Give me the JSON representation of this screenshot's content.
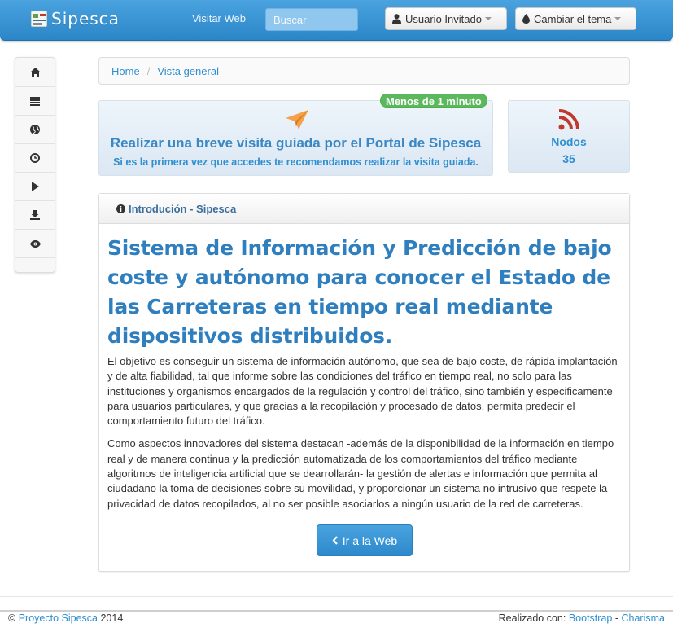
{
  "navbar": {
    "brand": "Sipesca",
    "visit_link": "Visitar Web",
    "search_placeholder": "Buscar",
    "user_button": "Usuario Invitado",
    "theme_button": "Cambiar el tema",
    "colors": {
      "bar": "#2b86c8",
      "accent": "#2f8fd0"
    }
  },
  "sidebar": {
    "items": [
      {
        "icon": "home-icon"
      },
      {
        "icon": "list-icon"
      },
      {
        "icon": "globe-icon"
      },
      {
        "icon": "clock-icon"
      },
      {
        "icon": "play-icon"
      },
      {
        "icon": "download-icon"
      },
      {
        "icon": "eye-icon"
      }
    ]
  },
  "breadcrumb": {
    "home": "Home",
    "separator": "/",
    "current": "Vista general"
  },
  "tour": {
    "badge": "Menos de 1 minuto",
    "title": "Realizar una breve visita guiada por el Portal de Sipesca",
    "subtitle": "Si es la primera vez que accedes te recomendamos realizar la visita guiada.",
    "icon": "paper-plane-icon"
  },
  "nodes": {
    "label": "Nodos",
    "count": "35",
    "icon": "rss-icon"
  },
  "intro": {
    "header": "Introdución - Sipesca",
    "heading": "Sistema de Información y Predicción de bajo coste y autónomo para conocer el Estado de las Carreteras en tiempo real mediante dispositivos distribuidos.",
    "paragraph1": "El objetivo es conseguir un sistema de información autónomo, que sea de bajo coste, de rápida implantación y de alta fiabilidad, tal que informe sobre las condiciones del tráfico en tiempo real, no solo para las instituciones y organismos encargados de la regulación y control del tráfico, sino también y especificamente para usuarios particulares, y que gracias a la recopilación y procesado de datos, permita predecir el comportamiento futuro del tráfico.",
    "paragraph2": "Como aspectos innovadores del sistema destacan -además de la disponibilidad de la información en tiempo real y de manera continua y la predicción automatizada de los comportamientos del tráfico mediante algoritmos de inteligencia artificial que se dearrollarán- la gestión de alertas e información que permita al ciudadano la toma de decisiones sobre su movilidad, y proporcionar un sistema no intrusivo que respete la privacidad de datos recopilados, al no ser posible asociarlos a ningún usuario de la red de carreteras.",
    "button": "Ir a la Web"
  },
  "footer": {
    "copyright_prefix": "©",
    "project_link": "Proyecto Sipesca",
    "year": "2014",
    "made_with": "Realizado con:",
    "bootstrap_link": "Bootstrap",
    "dash": "-",
    "charisma_link": "Charisma"
  }
}
